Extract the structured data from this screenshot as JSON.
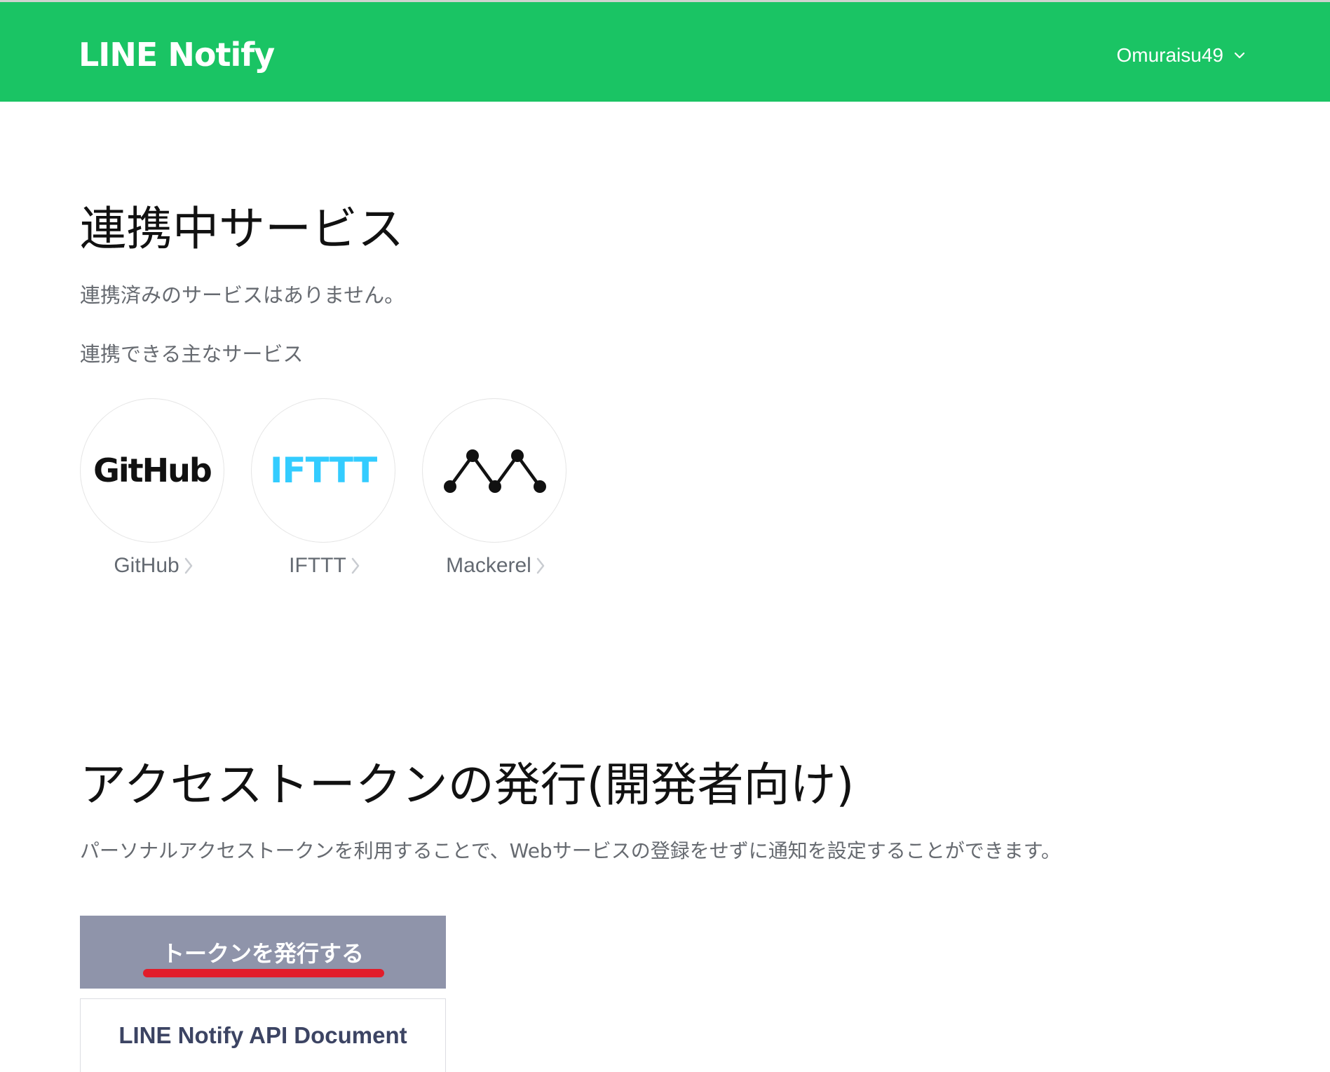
{
  "header": {
    "logo_text": "LINE Notify",
    "username": "Omuraisu49",
    "brand_color": "#1ac464"
  },
  "connected": {
    "title": "連携中サービス",
    "empty_message": "連携済みのサービスはありません。",
    "available_label": "連携できる主なサービス",
    "services": [
      {
        "label": "GitHub",
        "logo_text": "GitHub",
        "icon": "github-logo"
      },
      {
        "label": "IFTTT",
        "logo_text": "IFTTT",
        "icon": "ifttt-logo"
      },
      {
        "label": "Mackerel",
        "logo_text": "",
        "icon": "mackerel-logo"
      }
    ]
  },
  "token": {
    "title": "アクセストークンの発行(開発者向け)",
    "description": "パーソナルアクセストークンを利用することで、Webサービスの登録をせずに通知を設定することができます。",
    "issue_button_label": "トークンを発行する",
    "doc_button_label": "LINE Notify API Document"
  }
}
